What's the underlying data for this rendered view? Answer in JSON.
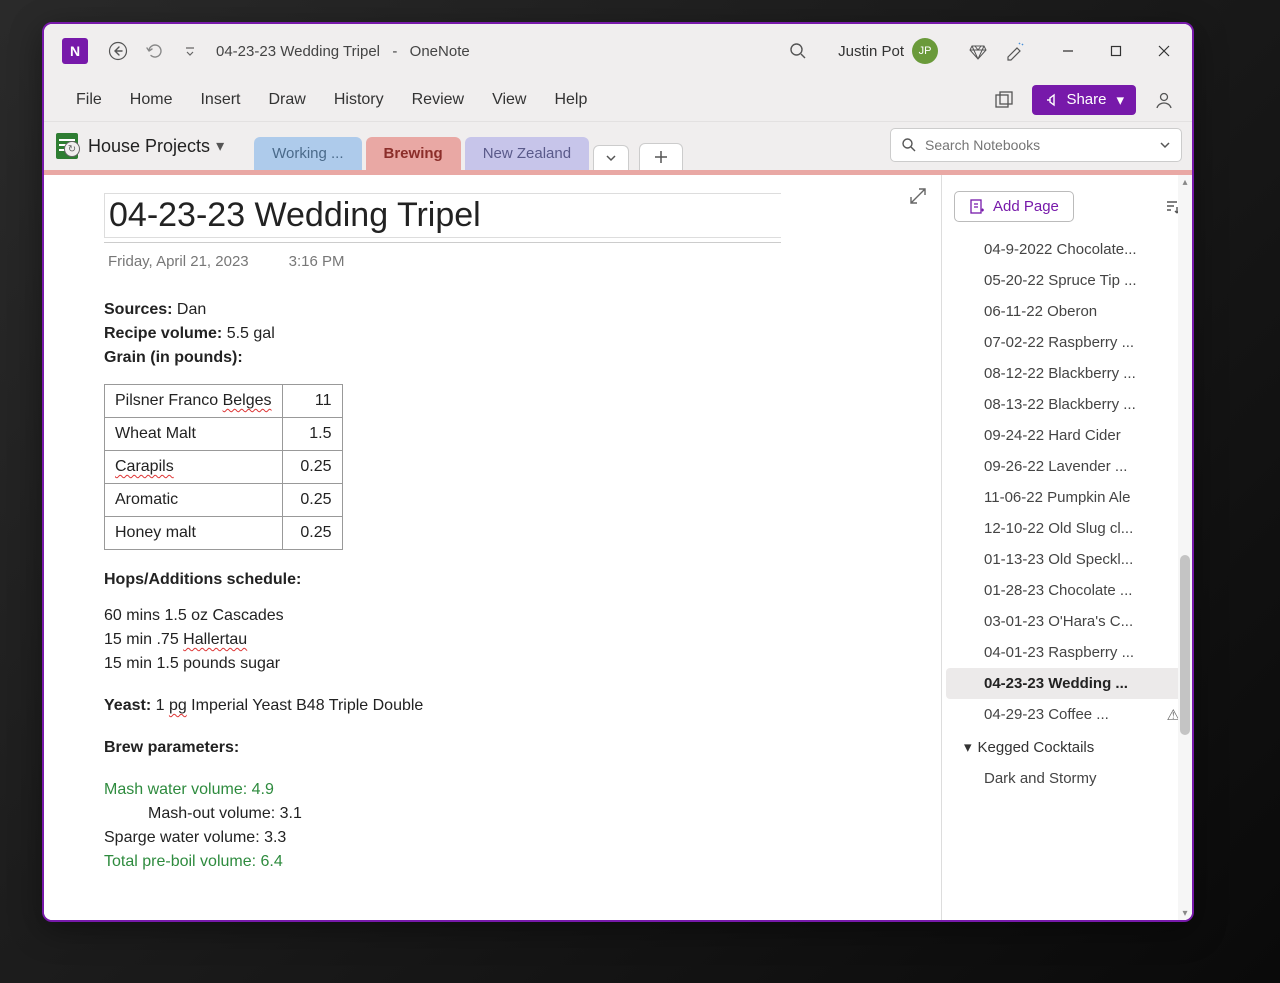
{
  "titlebar": {
    "doc_title": "04-23-23 Wedding Tripel",
    "separator": "-",
    "app_name": "OneNote",
    "user_name": "Justin Pot",
    "user_initials": "JP"
  },
  "ribbon": {
    "items": [
      "File",
      "Home",
      "Insert",
      "Draw",
      "History",
      "Review",
      "View",
      "Help"
    ],
    "share_label": "Share"
  },
  "notebook": {
    "name": "House Projects",
    "sections": [
      {
        "label": "Working ...",
        "cls": "tab-working"
      },
      {
        "label": "Brewing",
        "cls": "tab-brewing"
      },
      {
        "label": "New Zealand",
        "cls": "tab-nz"
      }
    ],
    "search_placeholder": "Search Notebooks"
  },
  "page": {
    "title": "04-23-23 Wedding Tripel",
    "date": "Friday, April 21, 2023",
    "time": "3:16 PM",
    "sources_label": "Sources:",
    "sources_value": " Dan",
    "volume_label": "Recipe volume:",
    "volume_value": " 5.5 gal",
    "grain_label": "Grain (in pounds):",
    "grain_table": [
      {
        "name_pre": "Pilsner Franco ",
        "name_spell": "Belges",
        "amt": "11"
      },
      {
        "name_pre": "Wheat Malt",
        "name_spell": "",
        "amt": "1.5"
      },
      {
        "name_pre": "",
        "name_spell": "Carapils",
        "amt": "0.25"
      },
      {
        "name_pre": "Aromatic",
        "name_spell": "",
        "amt": "0.25"
      },
      {
        "name_pre": "Honey malt",
        "name_spell": "",
        "amt": "0.25"
      }
    ],
    "hops_label": "Hops/Additions schedule:",
    "hops_lines": [
      "60 mins 1.5 oz Cascades",
      {
        "pre": "15 min .75 ",
        "spell": "Hallertau"
      },
      "15 min 1.5 pounds sugar"
    ],
    "yeast_label": "Yeast:",
    "yeast_pre": " 1 ",
    "yeast_spell": "pg",
    "yeast_post": " Imperial Yeast B48 Triple Double",
    "brew_label": "Brew parameters:",
    "mash_water": "Mash water volume: 4.9",
    "mash_out": "Mash-out volume: 3.1",
    "sparge": "Sparge water volume: 3.3",
    "preboil": "Total pre-boil volume: 6.4"
  },
  "pagelist": {
    "add_label": "Add Page",
    "items": [
      {
        "label": "04-9-2022 Chocolate..."
      },
      {
        "label": "05-20-22 Spruce Tip ..."
      },
      {
        "label": "06-11-22 Oberon"
      },
      {
        "label": "07-02-22 Raspberry ..."
      },
      {
        "label": "08-12-22 Blackberry ..."
      },
      {
        "label": "08-13-22 Blackberry ..."
      },
      {
        "label": "09-24-22 Hard Cider"
      },
      {
        "label": "09-26-22 Lavender ..."
      },
      {
        "label": "11-06-22 Pumpkin Ale"
      },
      {
        "label": "12-10-22 Old Slug cl..."
      },
      {
        "label": "01-13-23 Old Speckl..."
      },
      {
        "label": "01-28-23 Chocolate ..."
      },
      {
        "label": "03-01-23 O'Hara's C..."
      },
      {
        "label": "04-01-23 Raspberry ..."
      },
      {
        "label": "04-23-23 Wedding ...",
        "active": true
      },
      {
        "label": "04-29-23 Coffee ...",
        "warn": true
      }
    ],
    "group_label": "Kegged Cocktails",
    "sub_item": "Dark and Stormy"
  }
}
